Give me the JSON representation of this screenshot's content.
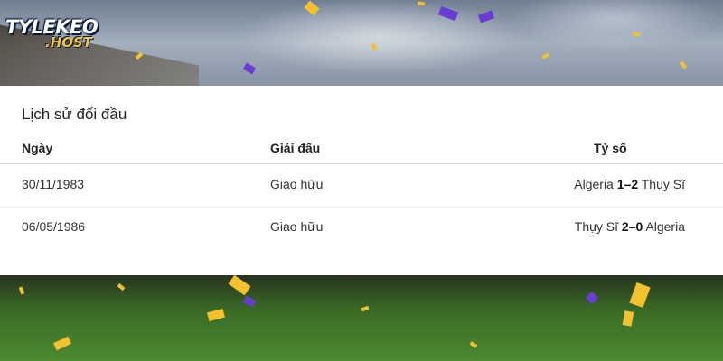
{
  "logo": {
    "main": "TYLEKEO",
    "sub": ".HOST"
  },
  "table": {
    "title": "Lịch sử đối đầu",
    "columns": {
      "date": "Ngày",
      "tournament": "Giải đấu",
      "score": "Tỷ số"
    },
    "rows": [
      {
        "date": "30/11/1983",
        "tournament": "Giao hữu",
        "home": "Algeria",
        "result": "1–2",
        "away": "Thụy Sĩ"
      },
      {
        "date": "06/05/1986",
        "tournament": "Giao hữu",
        "home": "Thụy Sĩ",
        "result": "2–0",
        "away": "Algeria"
      }
    ]
  },
  "colors": {
    "panel": "#ffffff",
    "accent": "#f4c542",
    "confetti_yellow": "#f2c12e",
    "confetti_purple": "#6a3cd6"
  }
}
